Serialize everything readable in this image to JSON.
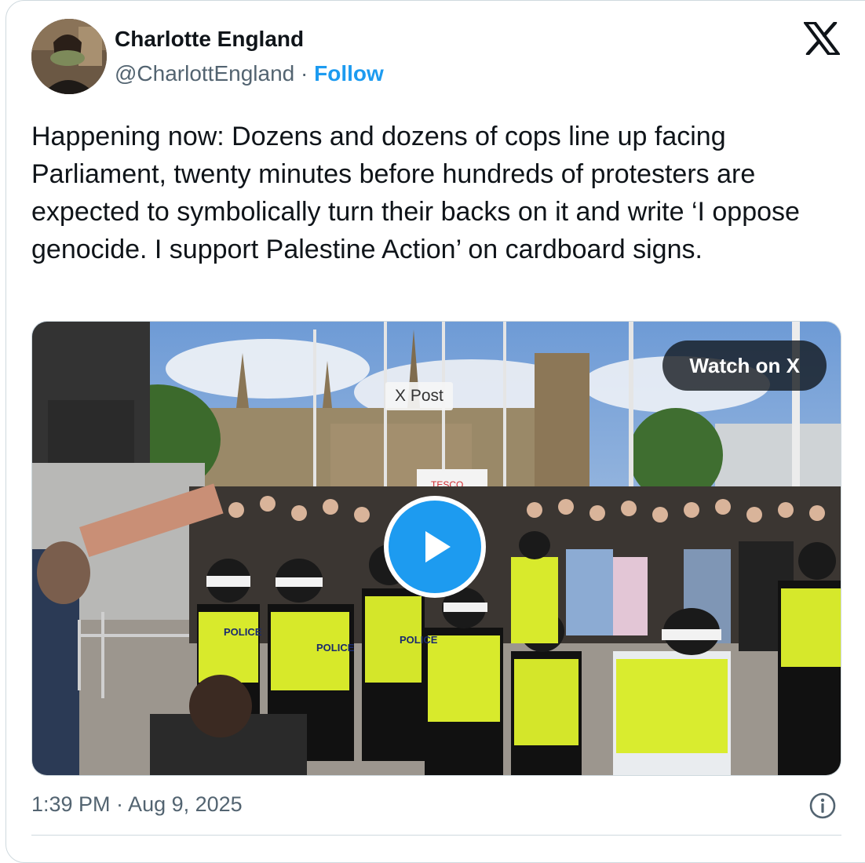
{
  "author": {
    "name": "Charlotte England",
    "handle": "@CharlottEngland",
    "separator": "·",
    "follow_label": "Follow"
  },
  "icons": {
    "platform": "x-logo-icon",
    "play": "play-icon",
    "info": "info-icon"
  },
  "tweet": {
    "text": "Happening now: Dozens and dozens of cops line up facing Parliament, twenty minutes before hundreds of protesters are expected to symbolically turn their backs on it and write ‘I oppose genocide. I support Palestine Action’ on cardboard signs.",
    "timestamp": "1:39 PM · Aug 9, 2025"
  },
  "media": {
    "watch_label": "Watch on X",
    "tooltip": "X Post",
    "vest_labels": [
      "POLICE",
      "POLICE",
      "POLICE"
    ],
    "truck_label": "TESCO"
  },
  "colors": {
    "accent": "#1d9bf0",
    "text": "#0f1419",
    "secondary": "#536471",
    "border": "#cfd9de"
  }
}
